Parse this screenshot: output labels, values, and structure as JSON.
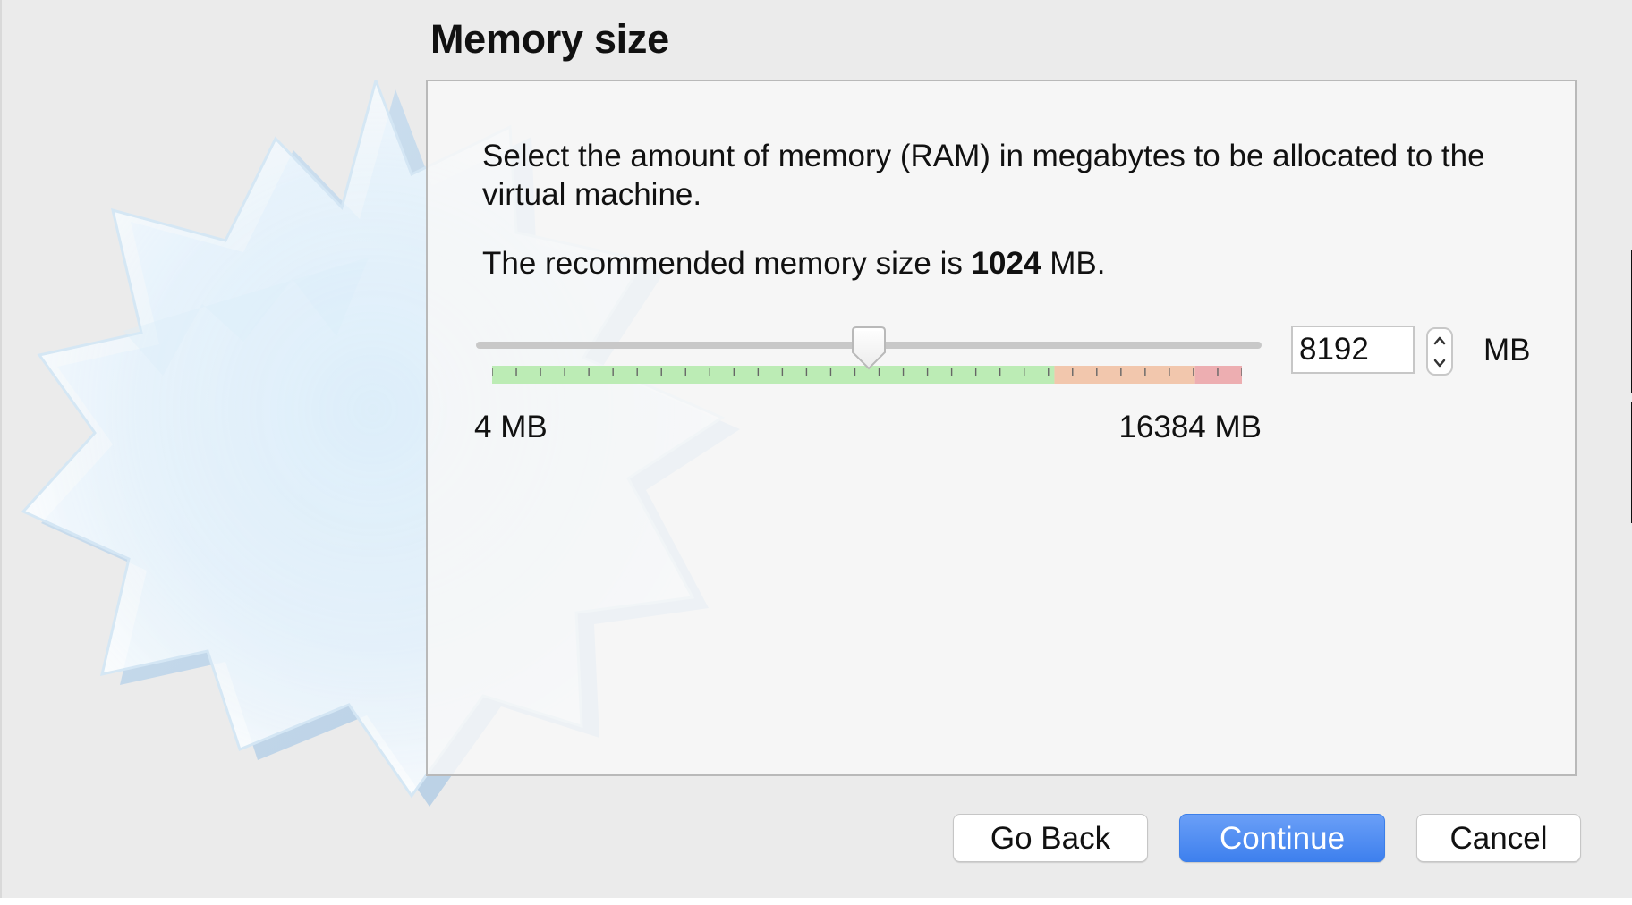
{
  "window": {
    "title": "Memory size"
  },
  "memory": {
    "description": "Select the amount of memory (RAM) in megabytes to be allocated to the virtual machine.",
    "recommendation_prefix": "The recommended memory size is",
    "recommended_value": "1024",
    "recommendation_suffix": "MB.",
    "selected_value": "8192",
    "selected_value_mb": 8192,
    "unit": "MB",
    "min_label": "4 MB",
    "max_label": "16384 MB",
    "min_mb": 4,
    "max_mb": 16384,
    "green_limit_mb": 12288,
    "orange_limit_mb": 15360,
    "tick_count": 32
  },
  "colors": {
    "green_range": "#bcecb5",
    "orange_range": "#f2c7ad",
    "red_range": "#edaeb1",
    "tick": "#666666",
    "primary_button": "#4b89f1"
  },
  "buttons": {
    "go_back": "Go Back",
    "continue": "Continue",
    "cancel": "Cancel"
  },
  "icons": {
    "gear": "gear-icon",
    "slider_thumb": "slider-thumb-icon",
    "stepper_up": "chevron-up-icon",
    "stepper_down": "chevron-down-icon"
  }
}
